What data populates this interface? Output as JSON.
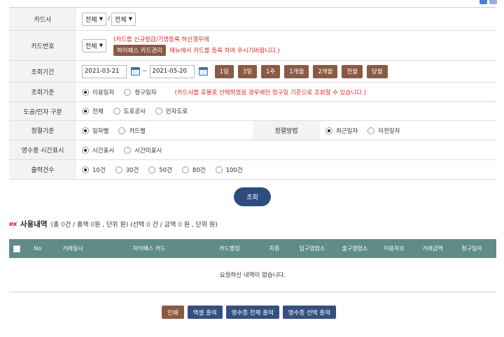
{
  "form": {
    "card_company": {
      "label": "카드사",
      "select1": "전체",
      "select2": "전체"
    },
    "card_number": {
      "label": "카드번호",
      "select": "전체",
      "notice_line1": "(카드를 신규발급/기명등록 하신경우에",
      "notice_button": "하이패스 카드관리",
      "notice_line2": "메뉴에서 카드를 등록 하여 주시기바랍니다.)"
    },
    "period": {
      "label": "조회기간",
      "start_date": "2021-03-21",
      "tilde": "~",
      "end_date": "2021-05-20",
      "buttons": [
        "1일",
        "3일",
        "1주",
        "1개월",
        "2개월",
        "전월",
        "당월"
      ]
    },
    "criteria": {
      "label": "조회기준",
      "options": [
        {
          "label": "이용일자",
          "checked": true
        },
        {
          "label": "청구일자",
          "checked": false
        }
      ],
      "note": "(카드사를 후불로 선택하였을 경우에만 청구일 기준으로 조회할 수 있습니다.)"
    },
    "road_type": {
      "label": "도공/민자 구분",
      "options": [
        {
          "label": "전체",
          "checked": true
        },
        {
          "label": "도로공사",
          "checked": false
        },
        {
          "label": "민자도로",
          "checked": false
        }
      ]
    },
    "sort": {
      "label": "정렬기준",
      "options": [
        {
          "label": "일자별",
          "checked": true
        },
        {
          "label": "카드별",
          "checked": false
        }
      ],
      "method_label": "정렬방법",
      "method_options": [
        {
          "label": "최근일자",
          "checked": true
        },
        {
          "label": "이전일자",
          "checked": false
        }
      ]
    },
    "receipt_time": {
      "label": "영수증 시간표시",
      "options": [
        {
          "label": "시간표시",
          "checked": true
        },
        {
          "label": "시간미표시",
          "checked": false
        }
      ]
    },
    "output_count": {
      "label": "출력건수",
      "options": [
        {
          "label": "10건",
          "checked": true
        },
        {
          "label": "30건",
          "checked": false
        },
        {
          "label": "50건",
          "checked": false
        },
        {
          "label": "80건",
          "checked": false
        },
        {
          "label": "100건",
          "checked": false
        }
      ]
    }
  },
  "search_button": "조회",
  "usage": {
    "logo_text": "ex",
    "title": "사용내역",
    "summary": {
      "p1": "(총 ",
      "count": "0",
      "p2": "건 / 총액 ",
      "amount": "0",
      "p3": "원 , 단위 원) (선택 ",
      "sel_count": "0",
      "p4": " 건 / 금액 ",
      "sel_amount": "0",
      "p5": " 원 , 단위 원)"
    }
  },
  "table": {
    "columns": [
      "No",
      "거래일시",
      "하이페스 카드",
      "카드별칭",
      "차종",
      "입구영업소",
      "출구영업소",
      "이용차로",
      "거래금액",
      "청구일자"
    ],
    "empty_message": "요청하신 내역이 없습니다."
  },
  "bottom_buttons": {
    "print": "인쇄",
    "excel": "엑셀 출력",
    "receipt_all": "영수증 전체 출력",
    "receipt_selected": "영수증 선택 출력"
  },
  "colors": {
    "action_brown": "#8a5a44",
    "navy": "#2f4c7e",
    "table_header": "#5f8c88",
    "notice_red": "#d72a2a",
    "logo_red": "#d8232a"
  }
}
